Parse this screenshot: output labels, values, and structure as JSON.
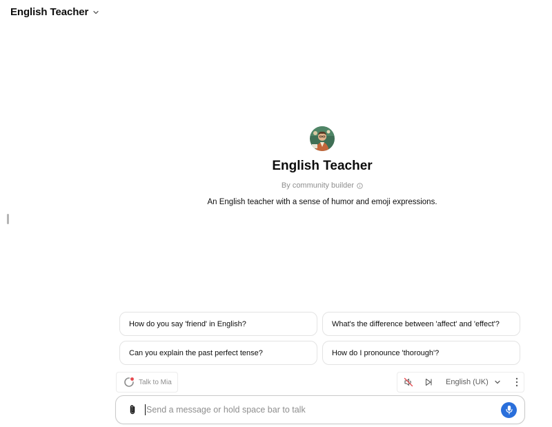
{
  "header": {
    "title": "English Teacher"
  },
  "gpt": {
    "name": "English Teacher",
    "author": "By community builder",
    "description": "An English teacher with a sense of humor and emoji expressions."
  },
  "starters": [
    "How do you say 'friend' in English?",
    "What's the difference between 'affect' and 'effect'?",
    "Can you explain the past perfect tense?",
    "How do I pronounce 'thorough'?"
  ],
  "voice": {
    "talk_label": "Talk to Mia",
    "language": "English (UK)"
  },
  "composer": {
    "placeholder": "Send a message or hold space bar to talk"
  },
  "colors": {
    "accent": "#2a6fdb",
    "status_dot": "#e5484d",
    "muted_slash": "#e5484d"
  },
  "icons": [
    "chevron-down-icon",
    "info-icon",
    "loading-ring-icon",
    "speaker-muted-icon",
    "play-icon",
    "more-vertical-icon",
    "paperclip-icon",
    "microphone-icon"
  ]
}
